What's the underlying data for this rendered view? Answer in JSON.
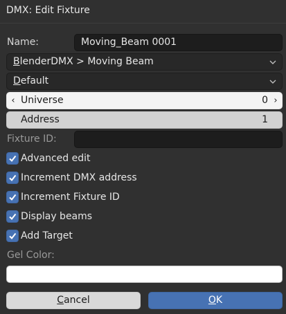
{
  "dialog": {
    "title": "DMX: Edit Fixture",
    "name_label": "Name:",
    "name_value": "Moving_Beam 0001",
    "profile_first": "B",
    "profile_rest": "lenderDMX > Moving Beam",
    "mode_first": "D",
    "mode_rest": "efault",
    "universe_label": "Universe",
    "universe_value": "0",
    "address_label": "Address",
    "address_value": "1",
    "fixture_id_label": "Fixture ID:",
    "fixture_id_value": "",
    "options": [
      {
        "label": "Advanced edit",
        "checked": true
      },
      {
        "label": "Increment DMX address",
        "checked": true
      },
      {
        "label": "Increment Fixture ID",
        "checked": true
      },
      {
        "label": "Display beams",
        "checked": true
      },
      {
        "label": "Add Target",
        "checked": true
      }
    ],
    "gel_label": "Gel Color:",
    "gel_color": "#ffffff",
    "cancel_first": "C",
    "cancel_rest": "ancel",
    "ok_first": "O",
    "ok_rest": "K"
  },
  "colors": {
    "background": "#303030",
    "accent": "#4772b3",
    "field_dark": "#1d1d1d"
  },
  "icons": [
    "chevron-down-icon",
    "chevron-left-icon",
    "chevron-right-icon",
    "checkmark-icon"
  ]
}
